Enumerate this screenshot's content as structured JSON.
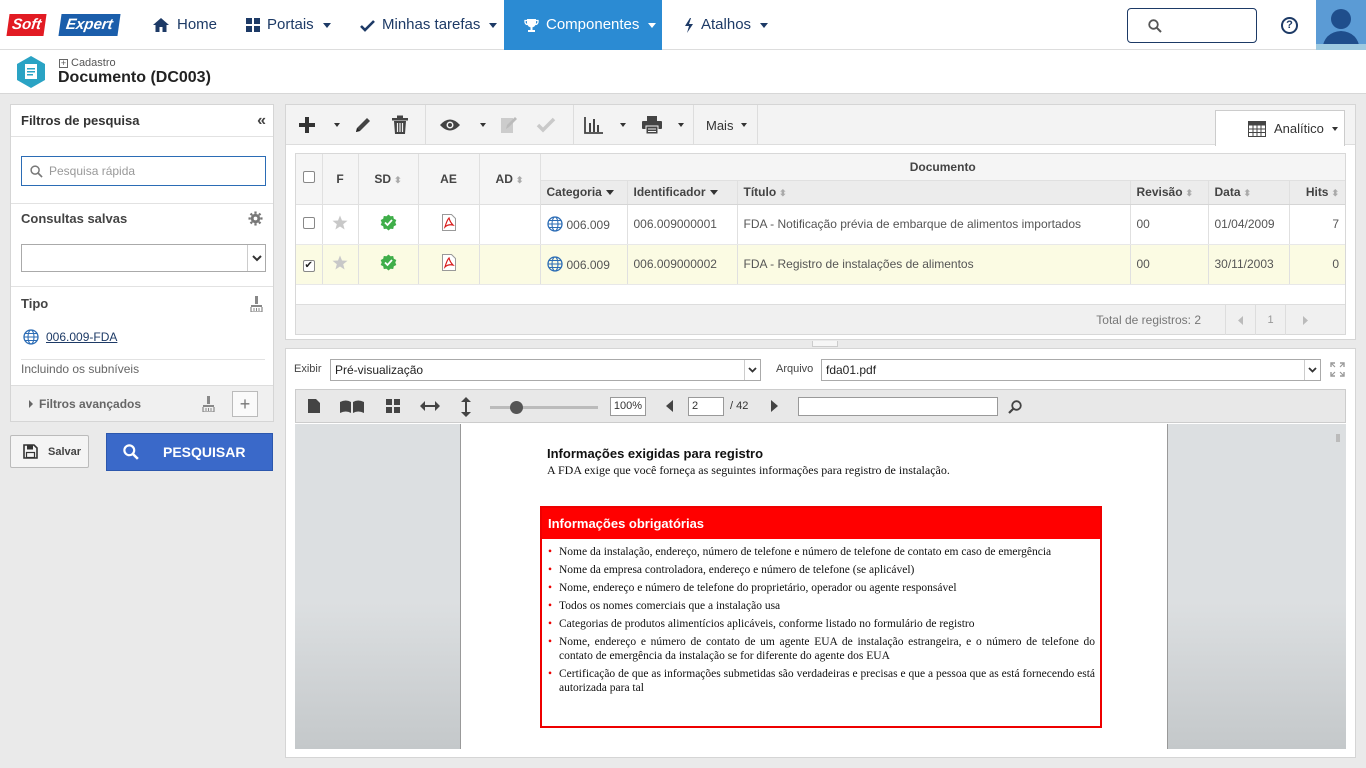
{
  "brand": {
    "soft": "Soft",
    "expert": "Expert"
  },
  "nav": {
    "home": "Home",
    "portais": "Portais",
    "tarefas": "Minhas tarefas",
    "componentes": "Componentes",
    "atalhos": "Atalhos"
  },
  "header": {
    "breadcrumb": "Cadastro",
    "title": "Documento (DC003)"
  },
  "filters": {
    "title": "Filtros de pesquisa",
    "quick_search_placeholder": "Pesquisa rápida",
    "saved_queries": "Consultas salvas",
    "tipo_label": "Tipo",
    "tipo_value": "006.009-FDA",
    "sublevels": "Incluindo os subníveis",
    "advanced": "Filtros avançados",
    "save_button": "Salvar",
    "search_button": "PESQUISAR"
  },
  "toolbar": {
    "mais": "Mais",
    "view_mode": "Analítico"
  },
  "table": {
    "group_header": "Documento",
    "columns": {
      "f": "F",
      "sd": "SD",
      "ae": "AE",
      "ad": "AD",
      "categoria": "Categoria",
      "identificador": "Identificador",
      "titulo": "Título",
      "revisao": "Revisão",
      "data": "Data",
      "hits": "Hits"
    },
    "rows": [
      {
        "selected": false,
        "categoria": "006.009",
        "identificador": "006.009000001",
        "titulo": "FDA - Notificação prévia de embarque de alimentos importados",
        "revisao": "00",
        "data": "01/04/2009",
        "hits": "7"
      },
      {
        "selected": true,
        "categoria": "006.009",
        "identificador": "006.009000002",
        "titulo": "FDA - Registro de instalações de alimentos",
        "revisao": "00",
        "data": "30/11/2003",
        "hits": "0"
      }
    ],
    "total": "Total de registros: 2",
    "page": "1"
  },
  "viewer": {
    "exibir_label": "Exibir",
    "exibir_value": "Pré-visualização",
    "arquivo_label": "Arquivo",
    "arquivo_value": "fda01.pdf",
    "zoom": "100%",
    "page_current": "2",
    "page_total": "/ 42"
  },
  "document": {
    "heading": "Informações exigidas para registro",
    "intro": "A FDA exige que você forneça as seguintes informações para registro de instalação.",
    "box_title": "Informações obrigatórias",
    "items": [
      "Nome da instalação, endereço, número de telefone e número de telefone de contato em caso de emergência",
      "Nome da empresa controladora, endereço e número de telefone (se aplicável)",
      "Nome, endereço e número de telefone do proprietário, operador ou agente responsável",
      "Todos os nomes comerciais que a instalação usa",
      "Categorias de produtos alimentícios aplicáveis, conforme listado no formulário de registro",
      "Nome, endereço e número de contato de um agente EUA de instalação estrangeira, e o número de telefone do contato de emergência da instalação se for diferente do agente dos EUA",
      "Certificação de que as informações submetidas são verdadeiras e precisas e que a pessoa que as está fornecendo está autorizada para tal"
    ]
  },
  "colors": {
    "accent": "#2b8bd3",
    "nav_text": "#1d3a66",
    "search_button": "#3a69c9",
    "red": "#ff0000",
    "selected_row": "#fbfbe3"
  }
}
